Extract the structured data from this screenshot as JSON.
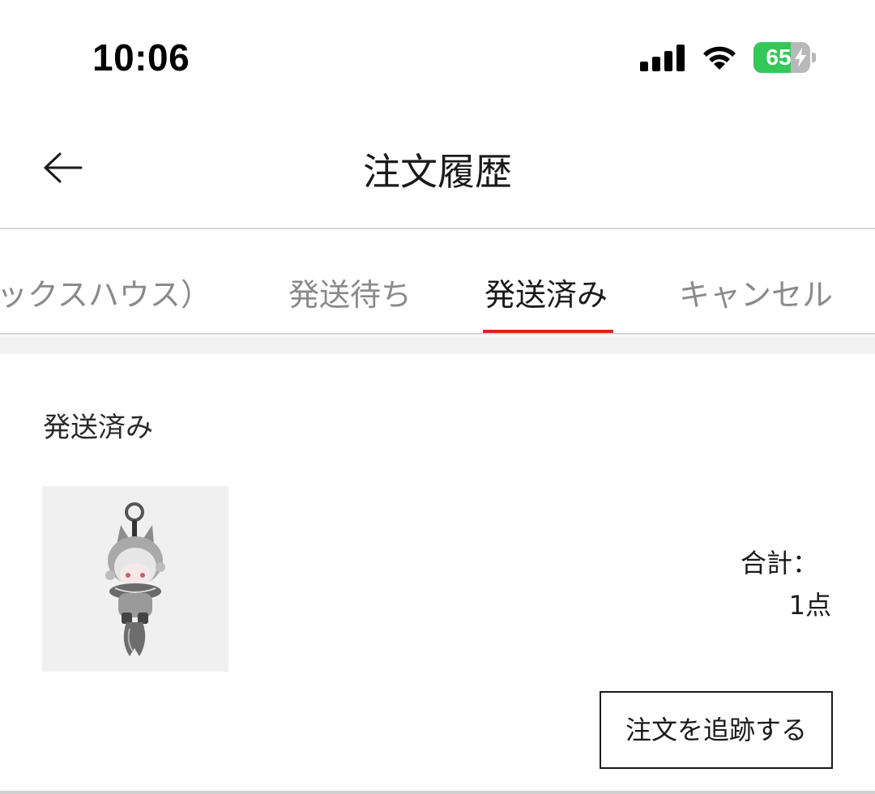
{
  "status_bar": {
    "time": "10:06",
    "battery_percent": 65,
    "battery_label": "65",
    "charging": true,
    "signal_bars": 4,
    "icons": [
      "cellular-signal-icon",
      "wifi-icon",
      "battery-icon",
      "charging-bolt-icon"
    ]
  },
  "header": {
    "back_icon": "back-arrow-icon",
    "title": "注文履歴"
  },
  "tabs": {
    "items": [
      {
        "label": "ックスハウス）",
        "active": false
      },
      {
        "label": "発送待ち",
        "active": false
      },
      {
        "label": "発送済み",
        "active": true
      },
      {
        "label": "キャンセル",
        "active": false
      }
    ],
    "accent_color": "#e0202a"
  },
  "order": {
    "status": "発送済み",
    "product_image": "fox-hood-doll-keychain-image",
    "total_label": "合計：",
    "total_count": "1点",
    "track_button_label": "注文を追跡する"
  }
}
